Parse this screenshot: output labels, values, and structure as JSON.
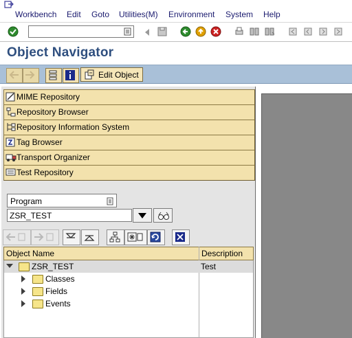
{
  "menu": {
    "items": [
      {
        "label": "Workbench"
      },
      {
        "label": "Edit"
      },
      {
        "label": "Goto"
      },
      {
        "label": "Utilities(M)"
      },
      {
        "label": "Environment"
      },
      {
        "label": "System"
      },
      {
        "label": "Help"
      }
    ]
  },
  "toolbar": {
    "command_value": "",
    "icons": [
      "enter-check-icon",
      "history-dropdown-icon",
      "nav-left-icon",
      "save-icon",
      "back-icon",
      "exit-icon",
      "cancel-icon",
      "print-icon",
      "find-icon",
      "find-next-icon",
      "first-page-icon",
      "prev-page-icon",
      "next-page-icon",
      "last-page-icon"
    ]
  },
  "page": {
    "title": "Object Navigator"
  },
  "app_toolbar": {
    "edit_object_label": "Edit Object"
  },
  "navigator": {
    "buttons": [
      {
        "label": "MIME Repository",
        "icon": "mime-repository-icon"
      },
      {
        "label": "Repository Browser",
        "icon": "repository-browser-icon"
      },
      {
        "label": "Repository Information System",
        "icon": "repository-info-icon"
      },
      {
        "label": "Tag Browser",
        "icon": "tag-browser-icon"
      },
      {
        "label": "Transport Organizer",
        "icon": "transport-truck-icon"
      },
      {
        "label": "Test Repository",
        "icon": "test-repository-icon"
      }
    ],
    "object_type": "Program",
    "object_name": "ZSR_TEST"
  },
  "tree": {
    "columns": [
      "Object Name",
      "Description"
    ],
    "rows": [
      {
        "name": "ZSR_TEST",
        "description": "Test",
        "expanded": true,
        "level": 0
      },
      {
        "name": "Classes",
        "description": "",
        "expanded": false,
        "level": 1
      },
      {
        "name": "Fields",
        "description": "",
        "expanded": false,
        "level": 1
      },
      {
        "name": "Events",
        "description": "",
        "expanded": false,
        "level": 1
      }
    ]
  },
  "colors": {
    "title": "#2f4f7f",
    "app_toolbar_bg": "#a9c0d8",
    "button_tan": "#f3e2ad",
    "panel_gray": "#e4e4e4",
    "right_pane_dark": "#888888"
  }
}
